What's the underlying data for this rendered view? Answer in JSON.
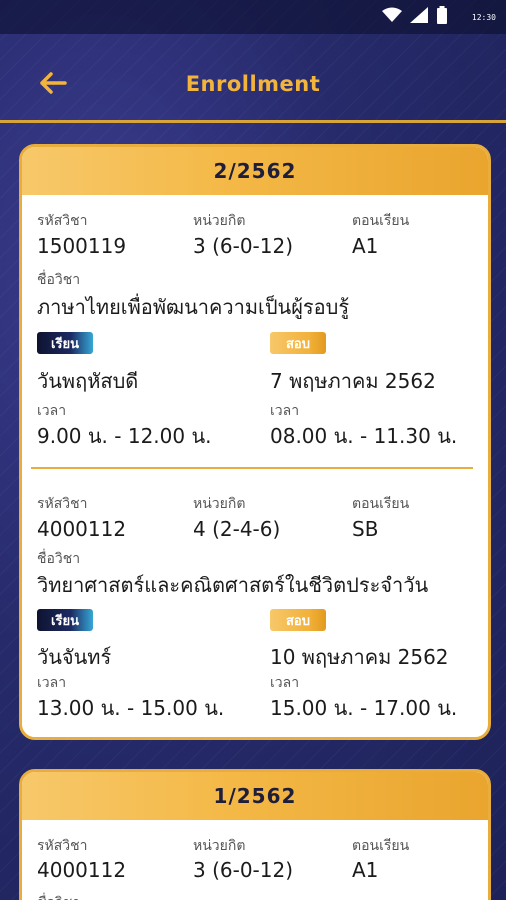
{
  "status_bar": {
    "time": "12:30"
  },
  "header": {
    "title": "Enrollment"
  },
  "terms": [
    {
      "term": "2/2562",
      "courses": [
        {
          "code_label": "รหัสวิชา",
          "code": "1500119",
          "credit_label": "หน่วยกิต",
          "credit": "3 (6-0-12)",
          "section_label": "ตอนเรียน",
          "section": "A1",
          "name_label": "ชื่อวิชา",
          "name": "ภาษาไทยเพื่อพัฒนาความเป็นผู้รอบรู้",
          "study_badge": "เรียน",
          "study_day": "วันพฤหัสบดี",
          "study_time_label": "เวลา",
          "study_time": "9.00 น. - 12.00 น.",
          "exam_badge": "สอบ",
          "exam_date": "7 พฤษภาคม 2562",
          "exam_time_label": "เวลา",
          "exam_time": "08.00 น. - 11.30 น."
        },
        {
          "code_label": "รหัสวิชา",
          "code": "4000112",
          "credit_label": "หน่วยกิต",
          "credit": "4 (2-4-6)",
          "section_label": "ตอนเรียน",
          "section": "SB",
          "name_label": "ชื่อวิชา",
          "name": "วิทยาศาสตร์และคณิตศาสตร์ในชีวิตประจำวัน",
          "study_badge": "เรียน",
          "study_day": "วันจันทร์",
          "study_time_label": "เวลา",
          "study_time": "13.00 น. - 15.00 น.",
          "exam_badge": "สอบ",
          "exam_date": "10 พฤษภาคม 2562",
          "exam_time_label": "เวลา",
          "exam_time": "15.00 น. - 17.00 น."
        }
      ]
    },
    {
      "term": "1/2562",
      "courses": [
        {
          "code_label": "รหัสวิชา",
          "code": "4000112",
          "credit_label": "หน่วยกิต",
          "credit": "3 (6-0-12)",
          "section_label": "ตอนเรียน",
          "section": "A1",
          "name_label": "ชื่อวิชา"
        }
      ]
    }
  ],
  "colors": {
    "accent_gold": "#f3b43c",
    "background_navy": "#252a67"
  },
  "icons": [
    "wifi-icon",
    "signal-icon",
    "battery-icon",
    "back-arrow-icon"
  ]
}
